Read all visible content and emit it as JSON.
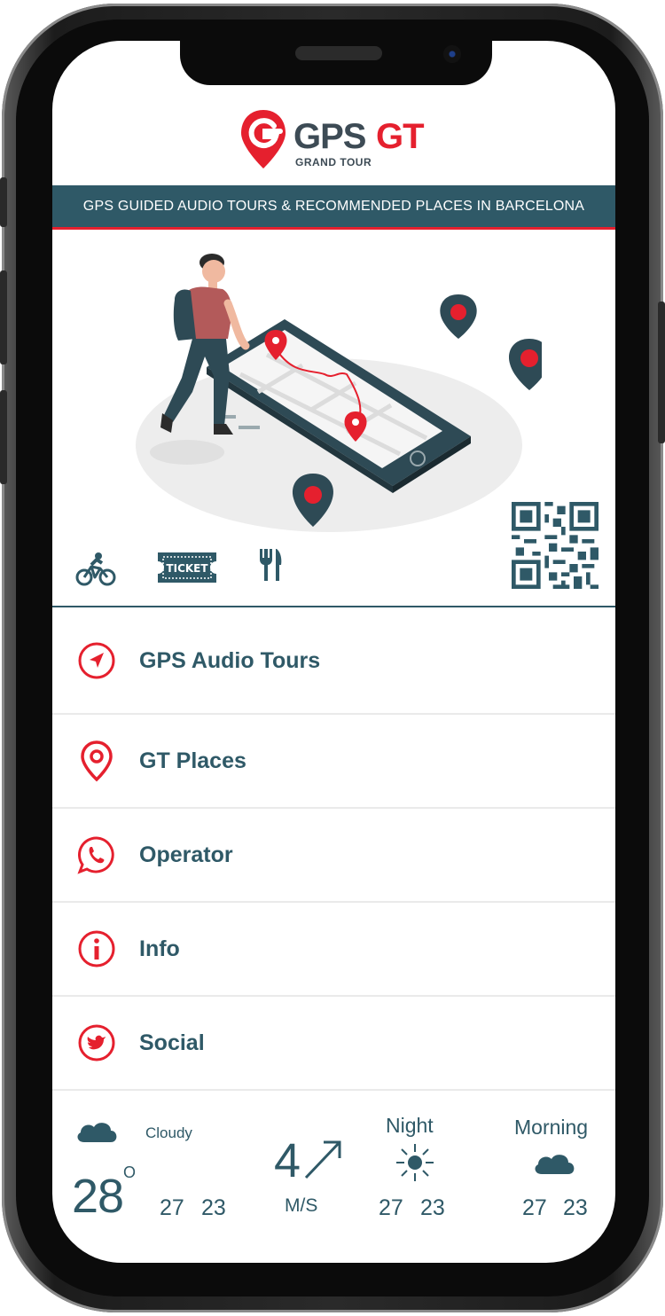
{
  "header": {
    "logo_primary": "GPS",
    "logo_secondary": "GT",
    "logo_subtitle": "GRAND TOUR",
    "banner": "GPS GUIDED AUDIO TOURS & RECOMMENDED PLACES IN BARCELONA"
  },
  "quick_icons": {
    "bike": "bike-icon",
    "ticket": "TICKET",
    "restaurant": "fork-knife-icon"
  },
  "menu": [
    {
      "label": "GPS Audio Tours",
      "icon": "navigation-arrow-icon"
    },
    {
      "label": "GT Places",
      "icon": "map-pin-icon"
    },
    {
      "label": "Operator",
      "icon": "whatsapp-icon"
    },
    {
      "label": "Info",
      "icon": "info-icon"
    },
    {
      "label": "Social",
      "icon": "twitter-icon"
    }
  ],
  "weather": {
    "current_condition": "Cloudy",
    "current_temp": "28",
    "degree": "O",
    "current_high": "27",
    "current_low": "23",
    "wind_speed": "4",
    "wind_unit": "M/S",
    "night_label": "Night",
    "night_high": "27",
    "night_low": "23",
    "morning_label": "Morning",
    "morning_high": "27",
    "morning_low": "23"
  },
  "colors": {
    "accent": "#e5202e",
    "primary": "#2f5967",
    "text_dark": "#3d4b55"
  }
}
